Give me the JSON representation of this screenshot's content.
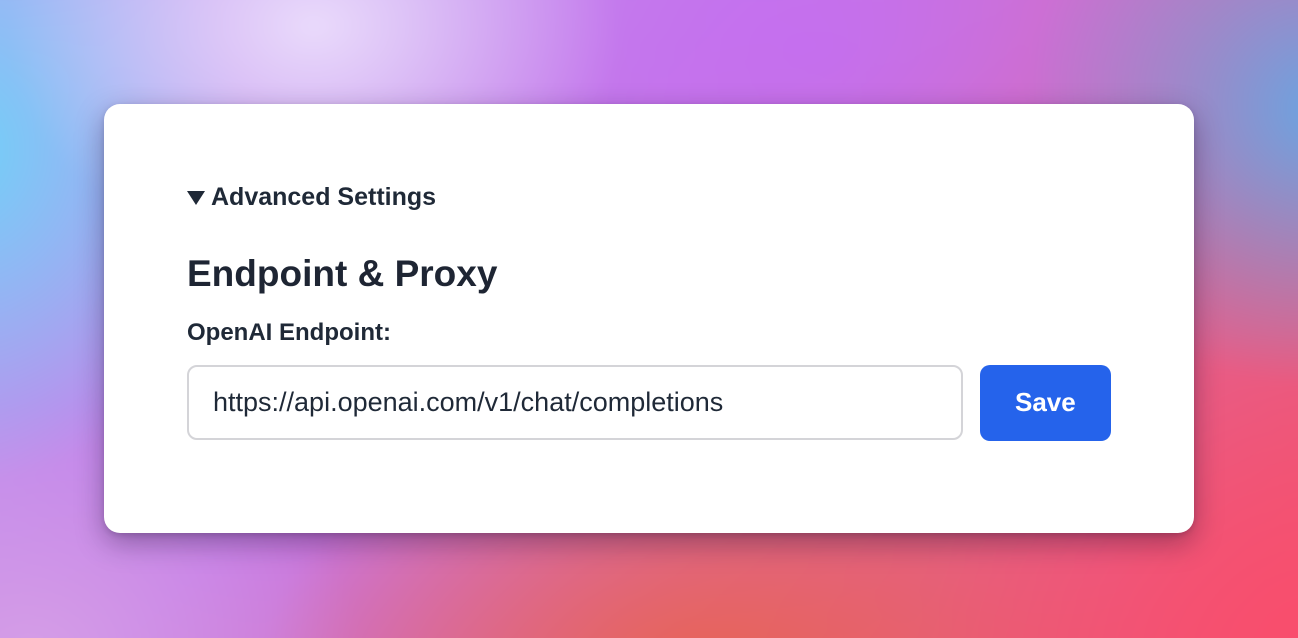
{
  "settings": {
    "summary_label": "Advanced Settings",
    "expanded": true,
    "section_title": "Endpoint & Proxy",
    "endpoint": {
      "label": "OpenAI Endpoint:",
      "value": "https://api.openai.com/v1/chat/completions"
    },
    "save_label": "Save"
  },
  "icons": {
    "disclosure": "triangle-down-icon"
  },
  "colors": {
    "accent": "#2563eb",
    "text": "#1f2937",
    "card": "#ffffff"
  }
}
